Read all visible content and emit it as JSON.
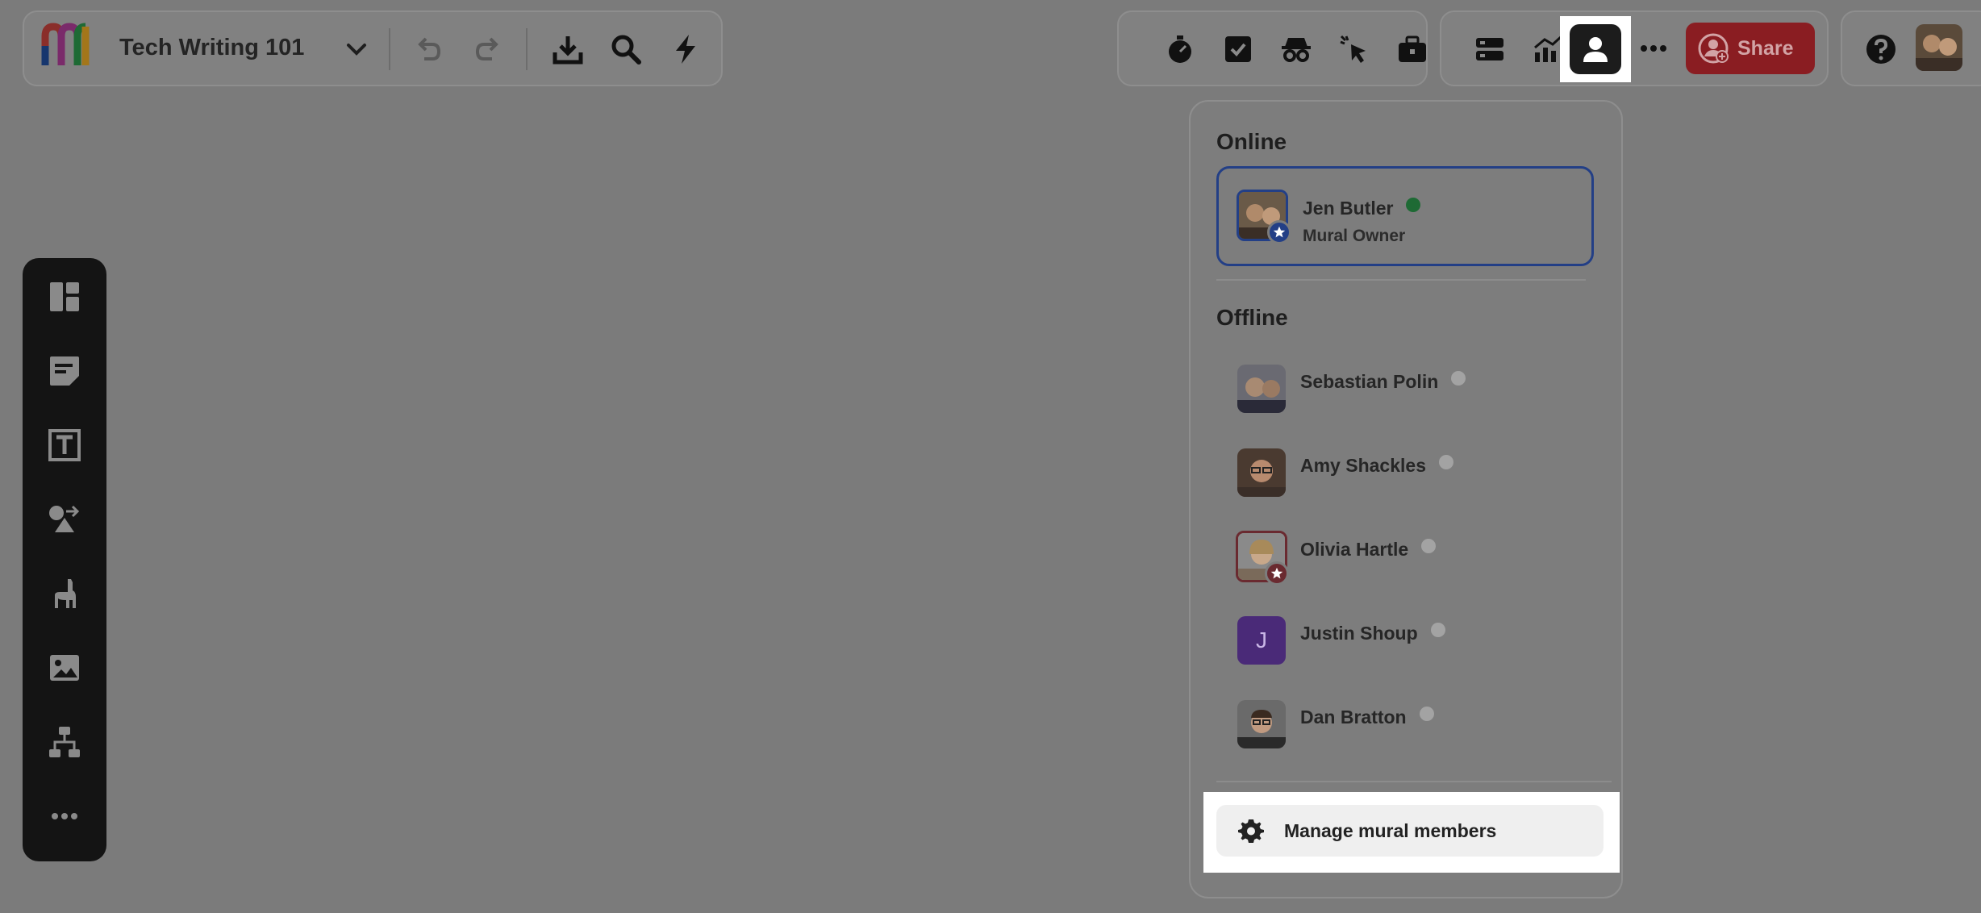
{
  "board": {
    "title": "Tech Writing 101"
  },
  "toolbar": {
    "share_label": "Share",
    "icons": [
      "logo",
      "chevron-down-icon",
      "undo-icon",
      "redo-icon",
      "download-icon",
      "search-icon",
      "lightning-icon",
      "timer-icon",
      "checkbox-icon",
      "private-mode-icon",
      "laser-pointer-icon",
      "toolbox-icon",
      "outline-icon",
      "activity-icon",
      "members-icon",
      "more-icon",
      "help-icon"
    ]
  },
  "left_rail": {
    "icons": [
      "templates-icon",
      "sticky-note-icon",
      "text-icon",
      "shapes-icon",
      "llama-icon",
      "image-icon",
      "diagram-icon",
      "more-icon"
    ]
  },
  "members_popover": {
    "online_heading": "Online",
    "offline_heading": "Offline",
    "online": [
      {
        "name": "Jen Butler",
        "role": "Mural Owner",
        "status": "online"
      }
    ],
    "offline": [
      {
        "name": "Sebastian Polin",
        "status": "offline"
      },
      {
        "name": "Amy Shackles",
        "status": "offline"
      },
      {
        "name": "Olivia Hartle",
        "status": "offline"
      },
      {
        "name": "Justin Shoup",
        "initial": "J",
        "status": "offline"
      },
      {
        "name": "Dan Bratton",
        "status": "offline"
      }
    ],
    "manage_label": "Manage mural members"
  },
  "colors": {
    "share_bg": "#8a1d22",
    "online_dot": "#1e6a34",
    "offline_dot": "#a3a3a3",
    "highlight_border": "#233f86",
    "justin_avatar": "#4a2a78"
  }
}
